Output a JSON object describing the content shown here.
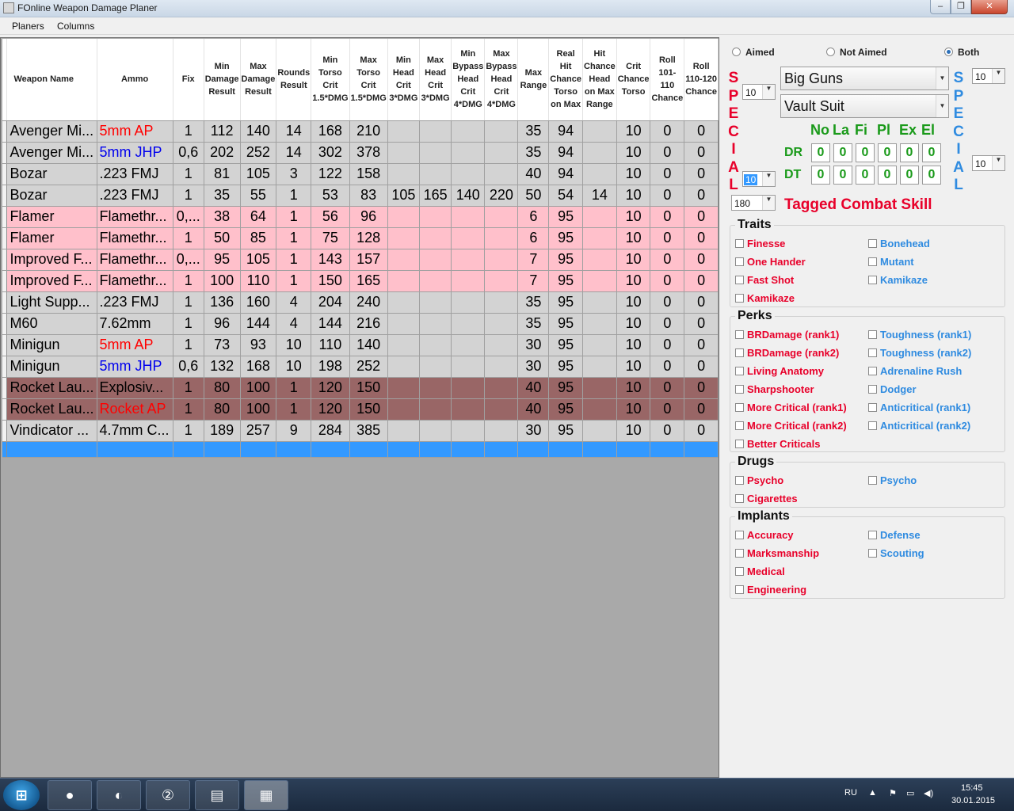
{
  "window": {
    "title": "FOnline Weapon Damage Planer",
    "min_glyph": "–",
    "max_glyph": "❐",
    "close_glyph": "✕"
  },
  "menu": [
    "Planers",
    "Columns"
  ],
  "grid": {
    "headers": [
      "Weapon Name",
      "Ammo",
      "Fix",
      "Min Damage Result",
      "Max Damage Result",
      "Rounds Result",
      "Min Torso Crit 1.5*DMG",
      "Max Torso Crit 1.5*DMG",
      "Min Head Crit 3*DMG",
      "Max Head Crit 3*DMG",
      "Min Bypass Head Crit 4*DMG",
      "Max Bypass Head Crit 4*DMG",
      "Max Range",
      "Real Hit Chance Torso on Max",
      "Hit Chance Head on Max Range",
      "Crit Chance Torso",
      "Roll 101-110 Chance",
      "Roll 110-120 Chance"
    ],
    "rows": [
      {
        "name": "Avenger Mi...",
        "ammo": "5mm AP",
        "ammo_color": "#ff0000",
        "fix": "1",
        "min": "112",
        "max": "140",
        "rounds": "14",
        "mintc": "168",
        "maxtc": "210",
        "minhc": "",
        "maxhc": "",
        "minbh": "",
        "maxbh": "",
        "range": "35",
        "rhc": "94",
        "hch": "",
        "crit": "10",
        "r1": "0",
        "r2": "0",
        "bg": "gray"
      },
      {
        "name": "Avenger Mi...",
        "ammo": "5mm JHP",
        "ammo_color": "#0000ee",
        "fix": "0,6",
        "min": "202",
        "max": "252",
        "rounds": "14",
        "mintc": "302",
        "maxtc": "378",
        "minhc": "",
        "maxhc": "",
        "minbh": "",
        "maxbh": "",
        "range": "35",
        "rhc": "94",
        "hch": "",
        "crit": "10",
        "r1": "0",
        "r2": "0",
        "bg": "gray"
      },
      {
        "name": "Bozar",
        "ammo": ".223 FMJ",
        "ammo_color": "#000000",
        "fix": "1",
        "min": "81",
        "max": "105",
        "rounds": "3",
        "mintc": "122",
        "maxtc": "158",
        "minhc": "",
        "maxhc": "",
        "minbh": "",
        "maxbh": "",
        "range": "40",
        "rhc": "94",
        "hch": "",
        "crit": "10",
        "r1": "0",
        "r2": "0",
        "bg": "gray"
      },
      {
        "name": "Bozar",
        "ammo": ".223 FMJ",
        "ammo_color": "#000000",
        "fix": "1",
        "min": "35",
        "max": "55",
        "rounds": "1",
        "mintc": "53",
        "maxtc": "83",
        "minhc": "105",
        "maxhc": "165",
        "minbh": "140",
        "maxbh": "220",
        "range": "50",
        "rhc": "54",
        "hch": "14",
        "crit": "10",
        "r1": "0",
        "r2": "0",
        "bg": "gray"
      },
      {
        "name": "Flamer",
        "ammo": "Flamethr...",
        "ammo_color": "#000000",
        "fix": "0,...",
        "min": "38",
        "max": "64",
        "rounds": "1",
        "mintc": "56",
        "maxtc": "96",
        "minhc": "",
        "maxhc": "",
        "minbh": "",
        "maxbh": "",
        "range": "6",
        "rhc": "95",
        "hch": "",
        "crit": "10",
        "r1": "0",
        "r2": "0",
        "bg": "pink"
      },
      {
        "name": "Flamer",
        "ammo": "Flamethr...",
        "ammo_color": "#000000",
        "fix": "1",
        "min": "50",
        "max": "85",
        "rounds": "1",
        "mintc": "75",
        "maxtc": "128",
        "minhc": "",
        "maxhc": "",
        "minbh": "",
        "maxbh": "",
        "range": "6",
        "rhc": "95",
        "hch": "",
        "crit": "10",
        "r1": "0",
        "r2": "0",
        "bg": "pink"
      },
      {
        "name": "Improved F...",
        "ammo": "Flamethr...",
        "ammo_color": "#000000",
        "fix": "0,...",
        "min": "95",
        "max": "105",
        "rounds": "1",
        "mintc": "143",
        "maxtc": "157",
        "minhc": "",
        "maxhc": "",
        "minbh": "",
        "maxbh": "",
        "range": "7",
        "rhc": "95",
        "hch": "",
        "crit": "10",
        "r1": "0",
        "r2": "0",
        "bg": "pink"
      },
      {
        "name": "Improved F...",
        "ammo": "Flamethr...",
        "ammo_color": "#000000",
        "fix": "1",
        "min": "100",
        "max": "110",
        "rounds": "1",
        "mintc": "150",
        "maxtc": "165",
        "minhc": "",
        "maxhc": "",
        "minbh": "",
        "maxbh": "",
        "range": "7",
        "rhc": "95",
        "hch": "",
        "crit": "10",
        "r1": "0",
        "r2": "0",
        "bg": "pink"
      },
      {
        "name": "Light Supp...",
        "ammo": ".223 FMJ",
        "ammo_color": "#000000",
        "fix": "1",
        "min": "136",
        "max": "160",
        "rounds": "4",
        "mintc": "204",
        "maxtc": "240",
        "minhc": "",
        "maxhc": "",
        "minbh": "",
        "maxbh": "",
        "range": "35",
        "rhc": "95",
        "hch": "",
        "crit": "10",
        "r1": "0",
        "r2": "0",
        "bg": "gray"
      },
      {
        "name": "M60",
        "ammo": "7.62mm",
        "ammo_color": "#000000",
        "fix": "1",
        "min": "96",
        "max": "144",
        "rounds": "4",
        "mintc": "144",
        "maxtc": "216",
        "minhc": "",
        "maxhc": "",
        "minbh": "",
        "maxbh": "",
        "range": "35",
        "rhc": "95",
        "hch": "",
        "crit": "10",
        "r1": "0",
        "r2": "0",
        "bg": "gray"
      },
      {
        "name": "Minigun",
        "ammo": "5mm AP",
        "ammo_color": "#ff0000",
        "fix": "1",
        "min": "73",
        "max": "93",
        "rounds": "10",
        "mintc": "110",
        "maxtc": "140",
        "minhc": "",
        "maxhc": "",
        "minbh": "",
        "maxbh": "",
        "range": "30",
        "rhc": "95",
        "hch": "",
        "crit": "10",
        "r1": "0",
        "r2": "0",
        "bg": "gray"
      },
      {
        "name": "Minigun",
        "ammo": "5mm JHP",
        "ammo_color": "#0000ee",
        "fix": "0,6",
        "min": "132",
        "max": "168",
        "rounds": "10",
        "mintc": "198",
        "maxtc": "252",
        "minhc": "",
        "maxhc": "",
        "minbh": "",
        "maxbh": "",
        "range": "30",
        "rhc": "95",
        "hch": "",
        "crit": "10",
        "r1": "0",
        "r2": "0",
        "bg": "gray"
      },
      {
        "name": "Rocket Lau...",
        "ammo": "Explosiv...",
        "ammo_color": "#000000",
        "fix": "1",
        "min": "80",
        "max": "100",
        "rounds": "1",
        "mintc": "120",
        "maxtc": "150",
        "minhc": "",
        "maxhc": "",
        "minbh": "",
        "maxbh": "",
        "range": "40",
        "rhc": "95",
        "hch": "",
        "crit": "10",
        "r1": "0",
        "r2": "0",
        "bg": "brown"
      },
      {
        "name": "Rocket Lau...",
        "ammo": "Rocket AP",
        "ammo_color": "#ff0000",
        "fix": "1",
        "min": "80",
        "max": "100",
        "rounds": "1",
        "mintc": "120",
        "maxtc": "150",
        "minhc": "",
        "maxhc": "",
        "minbh": "",
        "maxbh": "",
        "range": "40",
        "rhc": "95",
        "hch": "",
        "crit": "10",
        "r1": "0",
        "r2": "0",
        "bg": "brown"
      },
      {
        "name": "Vindicator ...",
        "ammo": "4.7mm C...",
        "ammo_color": "#000000",
        "fix": "1",
        "min": "189",
        "max": "257",
        "rounds": "9",
        "mintc": "284",
        "maxtc": "385",
        "minhc": "",
        "maxhc": "",
        "minbh": "",
        "maxbh": "",
        "range": "30",
        "rhc": "95",
        "hch": "",
        "crit": "10",
        "r1": "0",
        "r2": "0",
        "bg": "gray"
      }
    ]
  },
  "panel": {
    "aim": {
      "options": [
        "Aimed",
        "Not Aimed",
        "Both"
      ],
      "selected": "Both"
    },
    "special_letters": [
      "S",
      "P",
      "E",
      "C",
      "I",
      "A",
      "L"
    ],
    "left_combo_top": "10",
    "left_combo_mid": "10",
    "left_combo_bottom": "180",
    "right_combo_top": "10",
    "right_combo_mid": "10",
    "skill_combo": "Big Guns",
    "armor_combo": "Vault Suit",
    "resist_headers": [
      "No",
      "La",
      "Fi",
      "Pl",
      "Ex",
      "El"
    ],
    "dr_label": "DR",
    "dt_label": "DT",
    "dr_values": [
      "0",
      "0",
      "0",
      "0",
      "0",
      "0"
    ],
    "dt_values": [
      "0",
      "0",
      "0",
      "0",
      "0",
      "0"
    ],
    "tagged_label": "Tagged Combat Skill",
    "traits": {
      "title": "Traits",
      "left": [
        "Finesse",
        "One Hander",
        "Fast Shot",
        "Kamikaze"
      ],
      "right": [
        "Bonehead",
        "Mutant",
        "Kamikaze"
      ]
    },
    "perks": {
      "title": "Perks",
      "left": [
        "BRDamage (rank1)",
        "BRDamage (rank2)",
        "Living Anatomy",
        "Sharpshooter",
        "More Critical (rank1)",
        "More Critical (rank2)",
        "Better Criticals"
      ],
      "right": [
        "Toughness (rank1)",
        "Toughness (rank2)",
        "Adrenaline Rush",
        "Dodger",
        "Anticritical (rank1)",
        "Anticritical (rank2)"
      ]
    },
    "drugs": {
      "title": "Drugs",
      "left": [
        "Psycho",
        "Cigarettes"
      ],
      "right": [
        "Psycho"
      ]
    },
    "implants": {
      "title": "Implants",
      "left": [
        "Accuracy",
        "Marksmanship",
        "Medical",
        "Engineering"
      ],
      "right": [
        "Defense",
        "Scouting"
      ]
    }
  },
  "colors": {
    "red": "#e8002a",
    "blue": "#2f8be0",
    "green": "#1a9a1a",
    "selection": "#3399ff"
  },
  "taskbar": {
    "lang": "RU",
    "time": "15:45",
    "date": "30.01.2015"
  }
}
